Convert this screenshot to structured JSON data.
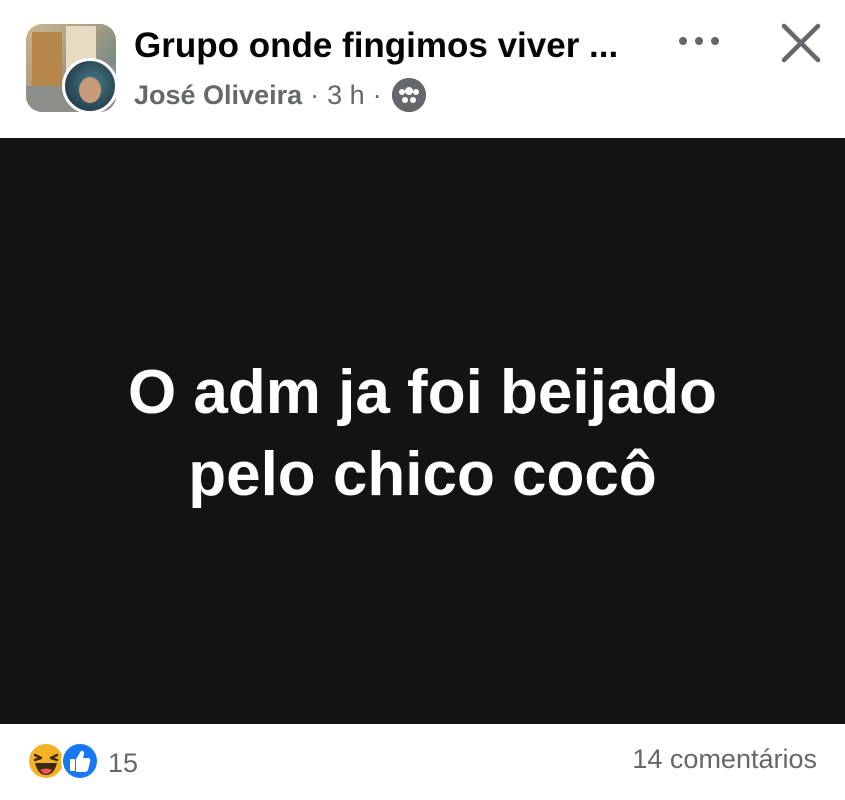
{
  "header": {
    "group_name": "Grupo onde fingimos viver ...",
    "author": "José Oliveira",
    "time": "3 h",
    "separator": "·"
  },
  "icons": {
    "audience": "group-audience-icon",
    "more": "more-options-icon",
    "close": "close-icon",
    "reaction_haha": "haha-reaction-icon",
    "reaction_like": "like-reaction-icon"
  },
  "post": {
    "line1": "O adm ja foi beijado",
    "line2": "pelo chico cocô",
    "background": "#131313"
  },
  "footer": {
    "reaction_count": "15",
    "comments": "14 comentários"
  },
  "colors": {
    "like_blue": "#1877f2",
    "haha_yellow": "#f7b125",
    "secondary_text": "#65676b"
  }
}
